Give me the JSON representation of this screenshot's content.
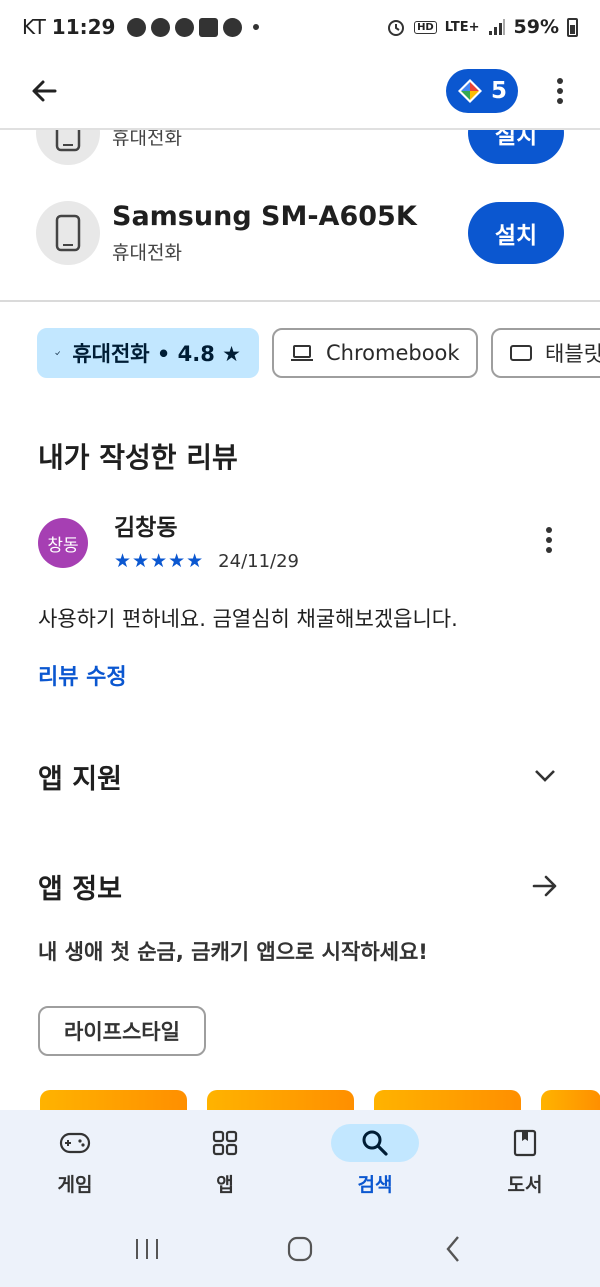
{
  "status_bar": {
    "carrier": "KT",
    "time": "11:29",
    "hd_label": "HD",
    "network": "LTE+",
    "battery": "59%"
  },
  "app_bar": {
    "points_count": "5"
  },
  "devices": [
    {
      "name": "",
      "type": "휴대전화",
      "install_label": "설치"
    },
    {
      "name": "Samsung SM-A605K",
      "type": "휴대전화",
      "install_label": "설치"
    }
  ],
  "filter_chips": [
    {
      "label": "휴대전화 • 4.8 ★",
      "selected": true
    },
    {
      "label": "Chromebook",
      "selected": false
    },
    {
      "label": "태블릿",
      "selected": false
    }
  ],
  "my_review": {
    "section_title": "내가 작성한 리뷰",
    "avatar_text": "창동",
    "reviewer_name": "김창동",
    "stars_text": "★★★★★",
    "rating": 5,
    "date": "24/11/29",
    "body": "사용하기 편하네요.  금열심히 채굴해보겠읍니다.",
    "edit_label": "리뷰 수정"
  },
  "app_support": {
    "title": "앱 지원"
  },
  "app_info": {
    "title": "앱 정보",
    "tagline": "내 생애 첫 순금, 금캐기 앱으로 시작하세요!",
    "category": "라이프스타일"
  },
  "bottom_nav": [
    {
      "label": "게임",
      "icon": "gamepad-icon",
      "active": false
    },
    {
      "label": "앱",
      "icon": "apps-grid-icon",
      "active": false
    },
    {
      "label": "검색",
      "icon": "search-icon",
      "active": true
    },
    {
      "label": "도서",
      "icon": "book-icon",
      "active": false
    }
  ],
  "colors": {
    "accent": "#0b57d0",
    "chip_selected": "#c2e7ff",
    "avatar": "#a63fb3",
    "nav_background": "#edf2fa",
    "promo": "#ff8f00"
  }
}
